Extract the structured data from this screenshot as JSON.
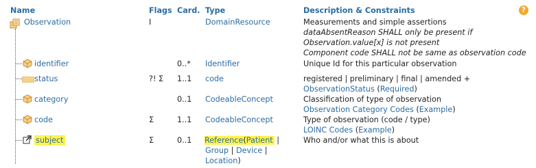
{
  "header": {
    "name": "Name",
    "flags": "Flags",
    "card": "Card.",
    "type": "Type",
    "desc": "Description & Constraints",
    "help_glyph": "?"
  },
  "rows": {
    "observation": {
      "name": "Observation",
      "flags": "I",
      "type": "DomainResource",
      "desc_lines": [
        "Measurements and simple assertions",
        "dataAbsentReason SHALL only be present if",
        "Observation.value[x] is not present",
        "Component code SHALL not be same as observation code"
      ]
    },
    "identifier": {
      "name": "identifier",
      "card": "0..*",
      "type": "Identifier",
      "desc": "Unique Id for this particular observation"
    },
    "status": {
      "name": "status",
      "flags": "?! Σ",
      "card": "1..1",
      "type": "code",
      "desc": "registered | preliminary | final | amended +",
      "binding_link": "ObservationStatus",
      "binding_open": " (",
      "binding_strength": "Required",
      "binding_close": ")"
    },
    "category": {
      "name": "category",
      "card": "0..1",
      "type": "CodeableConcept",
      "desc": "Classification of type of observation",
      "binding_link": "Observation Category Codes",
      "binding_open": " (",
      "binding_strength": "Example",
      "binding_close": ")"
    },
    "code": {
      "name": "code",
      "flags": "Σ",
      "card": "1..1",
      "type": "CodeableConcept",
      "desc": "Type of observation (code / type)",
      "binding_link": "LOINC Codes",
      "binding_open": " (",
      "binding_strength": "Example",
      "binding_close": ")"
    },
    "subject": {
      "name": "subject",
      "flags": "Σ",
      "card": "0..1",
      "type_ref": "Reference",
      "type_open": "(",
      "type_patient": "Patient",
      "type_sep1": " |",
      "type_group": "Group",
      "type_sep2": " |",
      "type_device": "Device",
      "type_sep3": " |",
      "type_location": "Location",
      "type_close": ")",
      "desc": "Who and/or what this is about"
    }
  },
  "colors": {
    "link": "#2b6ca3",
    "highlight": "#fff34d",
    "icon_brown": "#c8902f",
    "icon_fill": "#f6d18b",
    "help_orange": "#f0a92b"
  }
}
